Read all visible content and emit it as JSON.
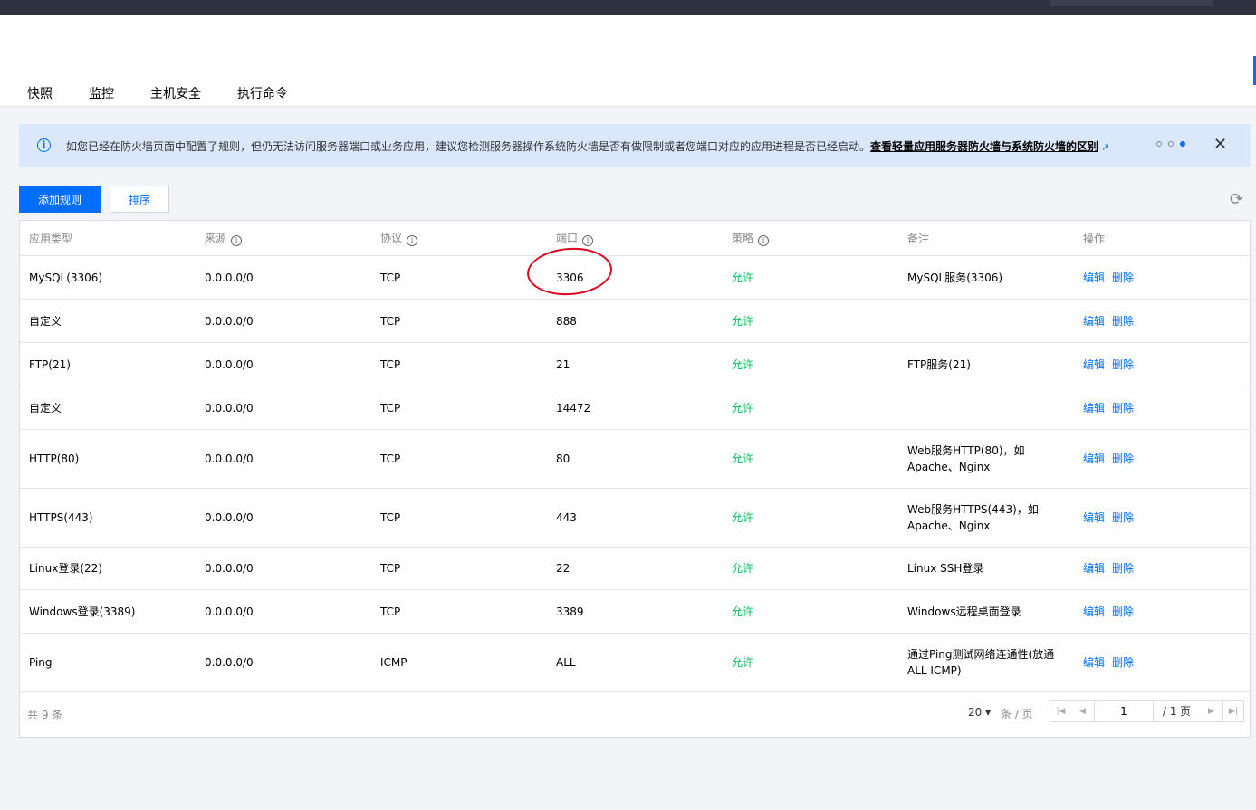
{
  "tabs": [
    "快照",
    "监控",
    "主机安全",
    "执行命令"
  ],
  "notice": {
    "text": "如您已经在防火墙页面中配置了规则，但仍无法访问服务器端口或业务应用，建议您检测服务器操作系统防火墙是否有做限制或者您端口对应的应用进程是否已经启动。",
    "link": "查看轻量应用服务器防火墙与系统防火墙的区别",
    "carousel_active": 3,
    "carousel_total": 3
  },
  "toolbar": {
    "add_label": "添加规则",
    "sort_label": "排序"
  },
  "table": {
    "headers": [
      "应用类型",
      "来源",
      "协议",
      "端口",
      "策略",
      "备注",
      "操作"
    ],
    "rows": [
      {
        "app": "MySQL(3306)",
        "source": "0.0.0.0/0",
        "protocol": "TCP",
        "port": "3306",
        "policy": "允许",
        "remark": "MySQL服务(3306)"
      },
      {
        "app": "自定义",
        "source": "0.0.0.0/0",
        "protocol": "TCP",
        "port": "888",
        "policy": "允许",
        "remark": ""
      },
      {
        "app": "FTP(21)",
        "source": "0.0.0.0/0",
        "protocol": "TCP",
        "port": "21",
        "policy": "允许",
        "remark": "FTP服务(21)"
      },
      {
        "app": "自定义",
        "source": "0.0.0.0/0",
        "protocol": "TCP",
        "port": "14472",
        "policy": "允许",
        "remark": ""
      },
      {
        "app": "HTTP(80)",
        "source": "0.0.0.0/0",
        "protocol": "TCP",
        "port": "80",
        "policy": "允许",
        "remark": "Web服务HTTP(80)，如Apache、Nginx"
      },
      {
        "app": "HTTPS(443)",
        "source": "0.0.0.0/0",
        "protocol": "TCP",
        "port": "443",
        "policy": "允许",
        "remark": "Web服务HTTPS(443)，如Apache、Nginx"
      },
      {
        "app": "Linux登录(22)",
        "source": "0.0.0.0/0",
        "protocol": "TCP",
        "port": "22",
        "policy": "允许",
        "remark": "Linux SSH登录"
      },
      {
        "app": "Windows登录(3389)",
        "source": "0.0.0.0/0",
        "protocol": "TCP",
        "port": "3389",
        "policy": "允许",
        "remark": "Windows远程桌面登录"
      },
      {
        "app": "Ping",
        "source": "0.0.0.0/0",
        "protocol": "ICMP",
        "port": "ALL",
        "policy": "允许",
        "remark": "通过Ping测试网络连通性(放通ALL ICMP)"
      }
    ],
    "edit_label": "编辑",
    "delete_label": "删除"
  },
  "pager": {
    "total": "共 9 条",
    "page_size": "20",
    "page_size_unit": "条 / 页",
    "current_page": "1",
    "total_pages": "/ 1 页"
  },
  "colors": {
    "accent": "#006eff",
    "allow": "#0abf5b",
    "highlight": "#e0001b"
  }
}
